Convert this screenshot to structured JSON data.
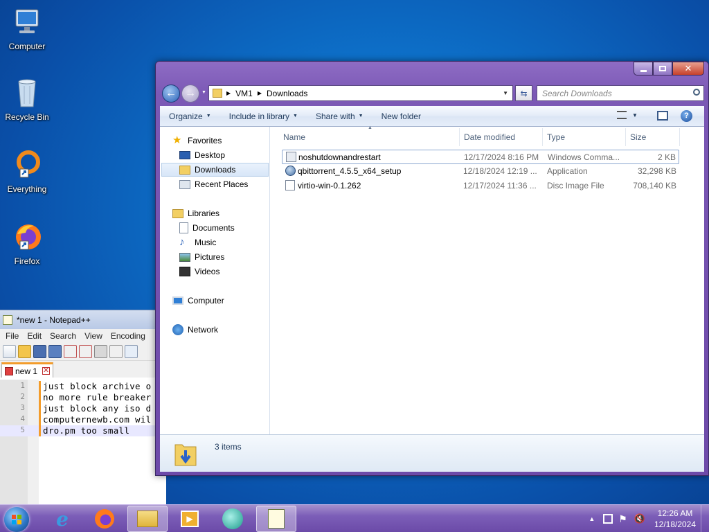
{
  "desktop": {
    "icons": [
      {
        "label": "Computer"
      },
      {
        "label": "Recycle Bin"
      },
      {
        "label": "Everything"
      },
      {
        "label": "Firefox"
      }
    ]
  },
  "notepad": {
    "title": "*new 1 - Notepad++",
    "menu": [
      "File",
      "Edit",
      "Search",
      "View",
      "Encoding"
    ],
    "tab_label": "new 1",
    "lines": [
      {
        "num": "1",
        "text": "just block archive o"
      },
      {
        "num": "2",
        "text": "no more rule breaker"
      },
      {
        "num": "3",
        "text": "just block any iso d"
      },
      {
        "num": "4",
        "text": "computernewb.com wil"
      },
      {
        "num": "5",
        "text": "dro.pm too small"
      }
    ]
  },
  "explorer": {
    "breadcrumb": [
      "VM1",
      "Downloads"
    ],
    "search_placeholder": "Search Downloads",
    "commands": {
      "organize": "Organize",
      "include": "Include in library",
      "share": "Share with",
      "new_folder": "New folder"
    },
    "nav": {
      "favorites": "Favorites",
      "desktop": "Desktop",
      "downloads": "Downloads",
      "recent": "Recent Places",
      "libraries": "Libraries",
      "documents": "Documents",
      "music": "Music",
      "pictures": "Pictures",
      "videos": "Videos",
      "computer": "Computer",
      "network": "Network"
    },
    "columns": {
      "name": "Name",
      "date": "Date modified",
      "type": "Type",
      "size": "Size"
    },
    "files": [
      {
        "name": "noshutdownandrestart",
        "date": "12/17/2024 8:16 PM",
        "type": "Windows Comma...",
        "size": "2 KB"
      },
      {
        "name": "qbittorrent_4.5.5_x64_setup",
        "date": "12/18/2024 12:19 ...",
        "type": "Application",
        "size": "32,298 KB"
      },
      {
        "name": "virtio-win-0.1.262",
        "date": "12/17/2024 11:36 ...",
        "type": "Disc Image File",
        "size": "708,140 KB"
      }
    ],
    "status": "3 items"
  },
  "taskbar": {
    "time": "12:26 AM",
    "date": "12/18/2024"
  }
}
